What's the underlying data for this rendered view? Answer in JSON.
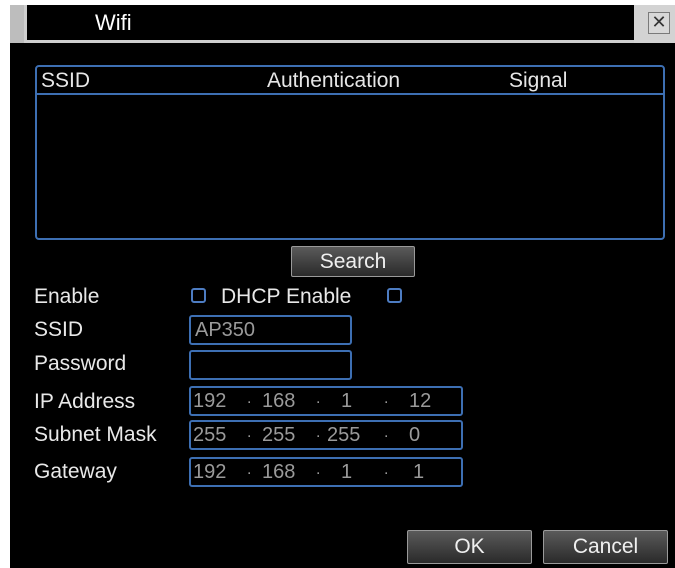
{
  "dialog": {
    "title": "Wifi",
    "close_glyph": "✕"
  },
  "list": {
    "columns": [
      "SSID",
      "Authentication",
      "Signal"
    ]
  },
  "buttons": {
    "search": "Search",
    "ok": "OK",
    "cancel": "Cancel"
  },
  "form": {
    "enable_label": "Enable",
    "dhcp_label": "DHCP Enable",
    "ssid_label": "SSID",
    "ssid_value": "AP350",
    "password_label": "Password",
    "password_value": "",
    "ip_label": "IP Address",
    "ip": [
      "192",
      "168",
      "1",
      "12"
    ],
    "mask_label": "Subnet Mask",
    "mask": [
      "255",
      "255",
      "255",
      "0"
    ],
    "gateway_label": "Gateway",
    "gateway": [
      "192",
      "168",
      "1",
      "1"
    ],
    "enable_checked": false,
    "dhcp_checked": false
  },
  "colors": {
    "accent": "#3d6fb3",
    "background": "#000000",
    "text": "#e8e8e8"
  }
}
